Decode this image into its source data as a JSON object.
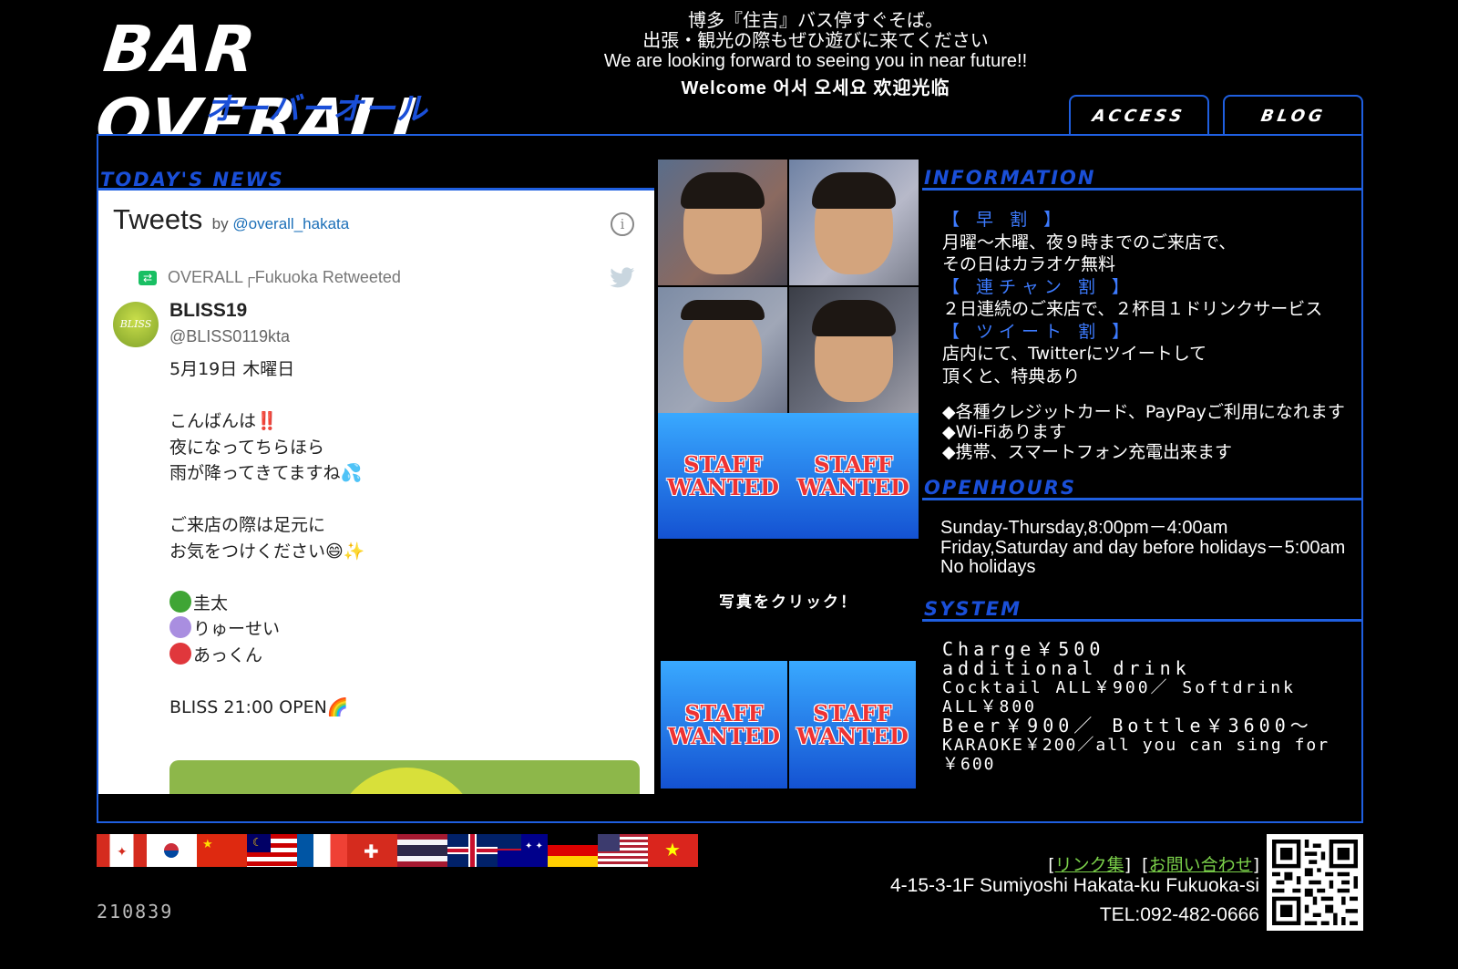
{
  "header": {
    "logo_main": "BAR OVERALL",
    "logo_sub": "オーバーオール",
    "tagline_lines": [
      "博多『住吉』バス停すぐそば。",
      "出張・観光の際もぜひ遊びに来てください",
      "We are looking forward to seeing you in near future!!"
    ],
    "welcome": "Welcome 어서 오세요  欢迎光临",
    "nav": {
      "access": "ACCESS",
      "blog": "BLOG"
    }
  },
  "news": {
    "title": "TODAY'S NEWS",
    "widget_title": "Tweets",
    "widget_by": "by",
    "widget_handle": "@overall_hakata",
    "retweet_line": "OVERALL┌Fukuoka Retweeted",
    "tweet": {
      "name": "BLISS19",
      "username": "@BLISS0119kta",
      "avatar_text": "BLISS",
      "date": "5月19日 木曜日",
      "greeting": "こんばんは‼️",
      "line1": "夜になってちらほら",
      "line2": "雨が降ってきてますね💦",
      "line3": "ご来店の際は足元に",
      "line4": "お気をつけください😄✨",
      "staff": [
        {
          "name": "圭太",
          "color": "#3fa535"
        },
        {
          "name": "りゅーせい",
          "color": "#a98ee0"
        },
        {
          "name": "あっくん",
          "color": "#e0373c"
        }
      ],
      "open": "BLISS 21:00 OPEN🌈"
    }
  },
  "photos": {
    "staff_wanted": [
      "STAFF",
      "WANTED"
    ],
    "click_text": "写真をクリック！"
  },
  "information": {
    "title": "INFORMATION",
    "early_label": "【 早 割 】",
    "early_text1": "月曜〜木曜、夜９時までのご来店で、",
    "early_text2": "その日はカラオケ無料",
    "consec_label": "【 連チャン 割 】",
    "consec_text": "２日連続のご来店で、２杯目１ドリンクサービス",
    "tweet_label": "【 ツイート 割 】",
    "tweet_text1": "店内にて、Twitterにツイートして",
    "tweet_text2": "頂くと、特典あり",
    "notes": [
      "◆各種クレジットカード、PayPayご利用になれます",
      "◆Wi-Fiあります",
      "◆携帯、スマートフォン充電出来ます"
    ]
  },
  "openhours": {
    "title": "OPENHOURS",
    "line1": "Sunday-Thursday,8:00pm－4:00am",
    "line2": "Friday,Saturday and day before holidays－5:00am",
    "line3": "No holidays"
  },
  "system": {
    "title": "SYSTEM",
    "line1": "Charge￥500",
    "line2": "additional drink",
    "line3": "Cocktail ALL￥900／ Softdrink ALL￥800",
    "line4": "Beer￥900／ Bottle￥3600～",
    "line5": "KARAOKE￥200／all you can sing for ￥600"
  },
  "footer": {
    "links": [
      "リンク集",
      "お問い合わせ"
    ],
    "address": "4-15-3-1F Sumiyoshi Hakata-ku Fukuoka-si",
    "tel": "TEL:092-482-0666",
    "visitor_count": "210839",
    "flags": [
      "canada",
      "korea",
      "china",
      "malaysia",
      "france",
      "switzerland",
      "thailand",
      "uk",
      "australia",
      "germany",
      "usa",
      "vietnam"
    ]
  },
  "colors": {
    "accent_blue": "#1f5fe0",
    "title_blue": "#1a4fd8",
    "link_green": "#7bd14a"
  }
}
